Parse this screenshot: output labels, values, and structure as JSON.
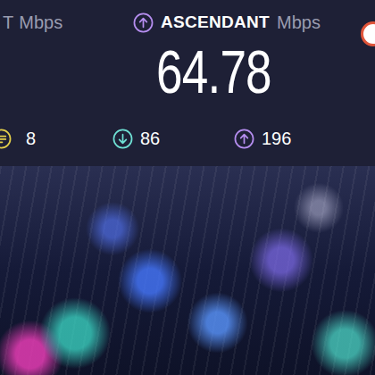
{
  "download": {
    "label": "T",
    "unit": "Mbps"
  },
  "upload": {
    "label": "ASCENDANT",
    "unit": "Mbps",
    "value": "64.78"
  },
  "stats": [
    {
      "kind": "ping",
      "value": "8",
      "color": "#e3cf4a"
    },
    {
      "kind": "download",
      "value": "86",
      "color": "#6fe0d4"
    },
    {
      "kind": "upload",
      "value": "196",
      "color": "#b68ef0"
    }
  ]
}
